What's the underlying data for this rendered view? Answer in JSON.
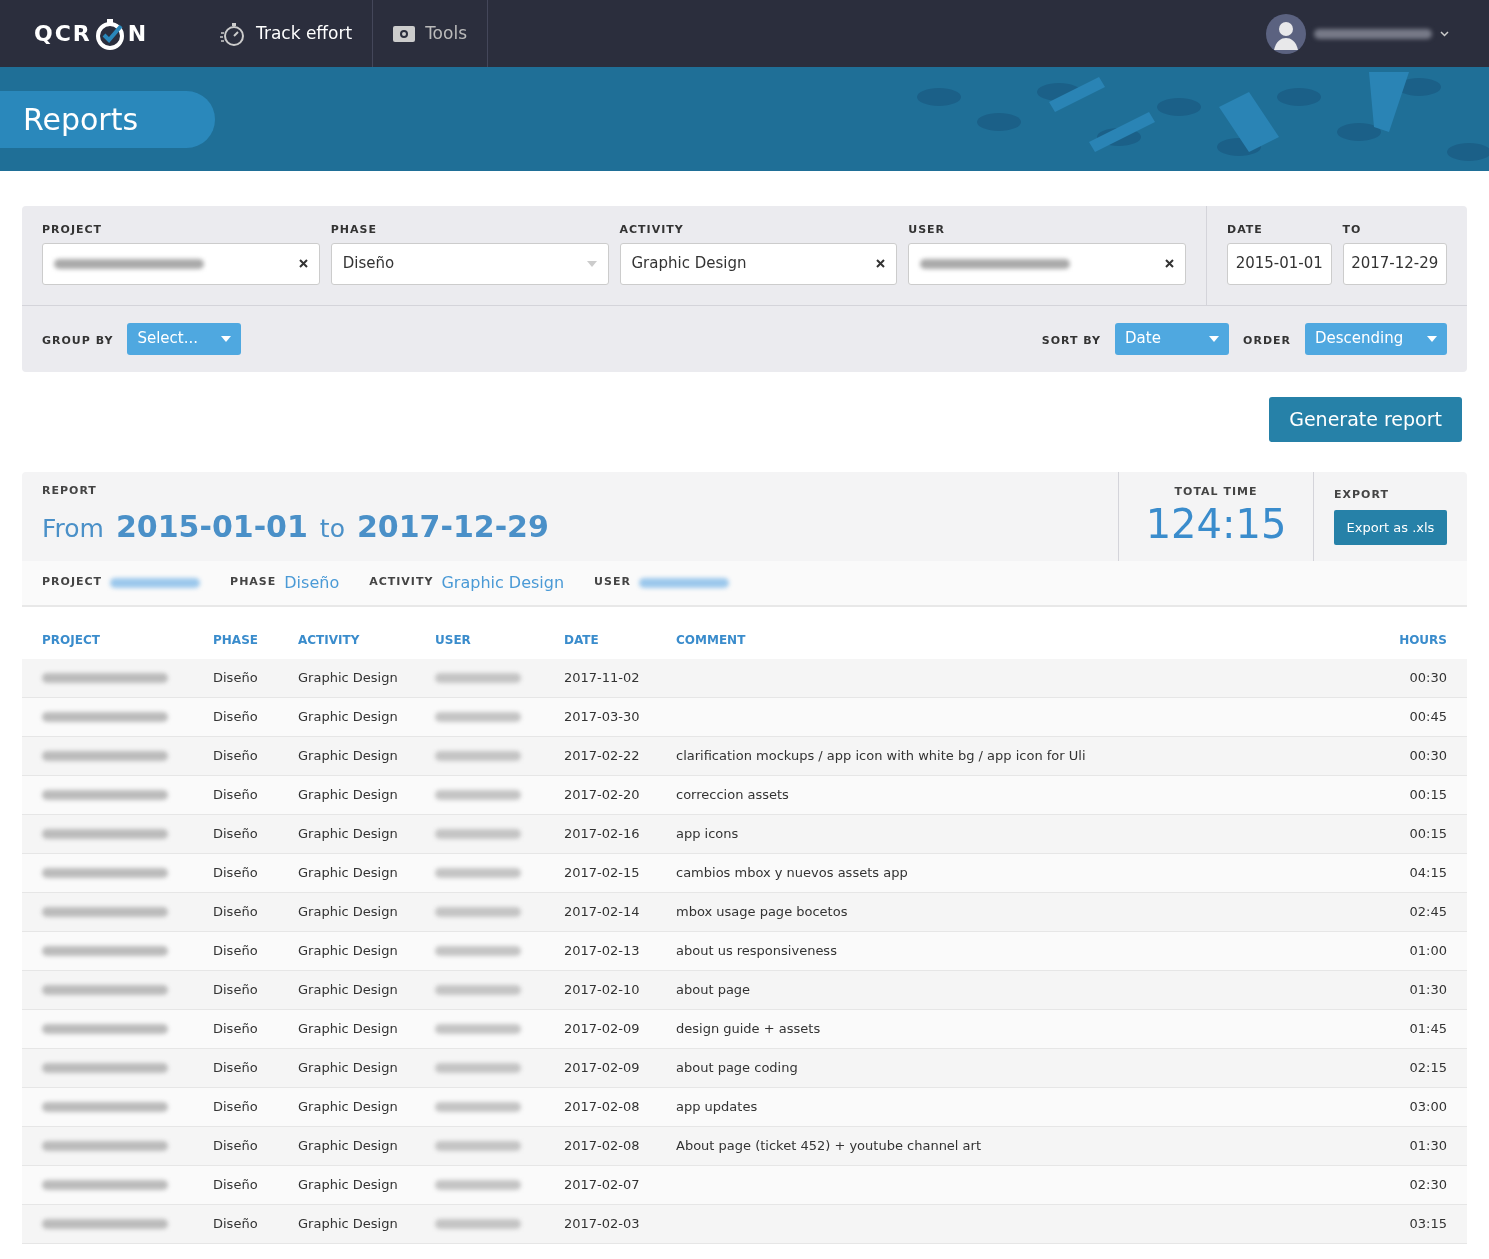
{
  "nav": {
    "logo": "QCR",
    "logo_end": "N",
    "items": [
      {
        "label": "Track effort",
        "kind": "timer",
        "selected": true
      },
      {
        "label": "Tools",
        "kind": "tools",
        "selected": false
      }
    ],
    "user": {
      "name_redacted": true
    }
  },
  "page_title": "Reports",
  "filters": {
    "fields": [
      {
        "label": "PROJECT",
        "kind": "clearable",
        "value_redacted": true
      },
      {
        "label": "PHASE",
        "kind": "dropdown",
        "value": "Diseño"
      },
      {
        "label": "ACTIVITY",
        "kind": "clearable",
        "value": "Graphic Design"
      },
      {
        "label": "USER",
        "kind": "clearable",
        "value_redacted": true
      }
    ],
    "date_label": "DATE",
    "date_from": "2015-01-01",
    "to_label": "TO",
    "date_to": "2017-12-29",
    "group_by_label": "GROUP BY",
    "group_by": "Select...",
    "sort_by_label": "SORT BY",
    "sort_by": "Date",
    "order_label": "ORDER",
    "order": "Descending"
  },
  "generate_button": "Generate report",
  "report": {
    "label": "REPORT",
    "from_word": "From",
    "from": "2015-01-01",
    "to_word": "to",
    "to": "2017-12-29",
    "total_label": "TOTAL TIME",
    "total": "124:15",
    "export_label": "EXPORT",
    "export_button": "Export as .xls",
    "summary": [
      {
        "label": "PROJECT",
        "value_redacted": true
      },
      {
        "label": "PHASE",
        "value": "Diseño"
      },
      {
        "label": "ACTIVITY",
        "value": "Graphic Design"
      },
      {
        "label": "USER",
        "value_redacted": true
      }
    ]
  },
  "table": {
    "columns": [
      "PROJECT",
      "PHASE",
      "ACTIVITY",
      "USER",
      "DATE",
      "COMMENT",
      "HOURS"
    ],
    "rows": [
      {
        "project_redacted": true,
        "phase": "Diseño",
        "activity": "Graphic Design",
        "user_redacted": true,
        "date": "2017-11-02",
        "comment": "",
        "hours": "00:30"
      },
      {
        "project_redacted": true,
        "phase": "Diseño",
        "activity": "Graphic Design",
        "user_redacted": true,
        "date": "2017-03-30",
        "comment": "",
        "hours": "00:45"
      },
      {
        "project_redacted": true,
        "phase": "Diseño",
        "activity": "Graphic Design",
        "user_redacted": true,
        "date": "2017-02-22",
        "comment": "clarification mockups / app icon with white bg / app icon for Uli",
        "hours": "00:30"
      },
      {
        "project_redacted": true,
        "phase": "Diseño",
        "activity": "Graphic Design",
        "user_redacted": true,
        "date": "2017-02-20",
        "comment": "correccion assets",
        "hours": "00:15"
      },
      {
        "project_redacted": true,
        "phase": "Diseño",
        "activity": "Graphic Design",
        "user_redacted": true,
        "date": "2017-02-16",
        "comment": "app icons",
        "hours": "00:15"
      },
      {
        "project_redacted": true,
        "phase": "Diseño",
        "activity": "Graphic Design",
        "user_redacted": true,
        "date": "2017-02-15",
        "comment": "cambios mbox y nuevos assets app",
        "hours": "04:15"
      },
      {
        "project_redacted": true,
        "phase": "Diseño",
        "activity": "Graphic Design",
        "user_redacted": true,
        "date": "2017-02-14",
        "comment": "mbox usage page bocetos",
        "hours": "02:45"
      },
      {
        "project_redacted": true,
        "phase": "Diseño",
        "activity": "Graphic Design",
        "user_redacted": true,
        "date": "2017-02-13",
        "comment": "about us responsiveness",
        "hours": "01:00"
      },
      {
        "project_redacted": true,
        "phase": "Diseño",
        "activity": "Graphic Design",
        "user_redacted": true,
        "date": "2017-02-10",
        "comment": "about page",
        "hours": "01:30"
      },
      {
        "project_redacted": true,
        "phase": "Diseño",
        "activity": "Graphic Design",
        "user_redacted": true,
        "date": "2017-02-09",
        "comment": "design guide + assets",
        "hours": "01:45"
      },
      {
        "project_redacted": true,
        "phase": "Diseño",
        "activity": "Graphic Design",
        "user_redacted": true,
        "date": "2017-02-09",
        "comment": "about page coding",
        "hours": "02:15"
      },
      {
        "project_redacted": true,
        "phase": "Diseño",
        "activity": "Graphic Design",
        "user_redacted": true,
        "date": "2017-02-08",
        "comment": "app updates",
        "hours": "03:00"
      },
      {
        "project_redacted": true,
        "phase": "Diseño",
        "activity": "Graphic Design",
        "user_redacted": true,
        "date": "2017-02-08",
        "comment": "About page (ticket 452) + youtube channel art",
        "hours": "01:30"
      },
      {
        "project_redacted": true,
        "phase": "Diseño",
        "activity": "Graphic Design",
        "user_redacted": true,
        "date": "2017-02-07",
        "comment": "",
        "hours": "02:30"
      },
      {
        "project_redacted": true,
        "phase": "Diseño",
        "activity": "Graphic Design",
        "user_redacted": true,
        "date": "2017-02-03",
        "comment": "",
        "hours": "03:15"
      }
    ]
  }
}
